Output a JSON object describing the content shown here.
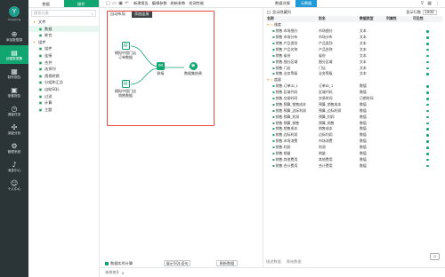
{
  "nav": {
    "logo_text": "Yonghong",
    "items": [
      {
        "label": "添加数据源",
        "icon": "plus-icon",
        "glyph": "⊕"
      },
      {
        "label": "创建数据集",
        "icon": "dataset-icon",
        "glyph": "▤",
        "active": true
      },
      {
        "label": "制作报告",
        "icon": "report-icon",
        "glyph": "▦"
      },
      {
        "label": "查看报告",
        "icon": "view-report-icon",
        "glyph": "▣"
      },
      {
        "label": "调度任务",
        "icon": "schedule-icon",
        "glyph": "◷"
      },
      {
        "label": "深度分析",
        "icon": "analysis-icon",
        "glyph": "✣"
      },
      {
        "label": "管理系统",
        "icon": "settings-icon",
        "glyph": "⚙"
      },
      {
        "label": "消息中心",
        "icon": "bell-icon",
        "glyph": "♪"
      },
      {
        "label": "个人中心",
        "icon": "user-icon",
        "glyph": "☺"
      }
    ]
  },
  "left": {
    "tabs": [
      "数据",
      "操作"
    ],
    "search_placeholder": "搜索元素",
    "tree": [
      {
        "label": "文件",
        "level": 0,
        "type": "folder"
      },
      {
        "label": "数据",
        "level": 1,
        "type": "item",
        "selected": true
      },
      {
        "label": "联合",
        "level": 1,
        "type": "item"
      },
      {
        "label": "组件",
        "level": 0,
        "type": "folder"
      },
      {
        "label": "组件",
        "level": 1,
        "type": "item"
      },
      {
        "label": "连接",
        "level": 1,
        "type": "item"
      },
      {
        "label": "合并",
        "level": 1,
        "type": "item"
      },
      {
        "label": "选择列",
        "level": 1,
        "type": "item"
      },
      {
        "label": "透视转换",
        "level": 1,
        "type": "item"
      },
      {
        "label": "分组和汇总",
        "level": 1,
        "type": "item"
      },
      {
        "label": "自助SQL",
        "level": 1,
        "type": "item"
      },
      {
        "label": "过滤",
        "level": 1,
        "type": "item"
      },
      {
        "label": "计算",
        "level": 1,
        "type": "item"
      },
      {
        "label": "主题",
        "level": 1,
        "type": "item"
      }
    ]
  },
  "toolbar": {
    "icons": [
      "新建",
      "打开",
      "保存",
      "撤销"
    ],
    "labels": [
      "新建报告",
      "编辑参数",
      "刷新参数",
      "检测性能"
    ]
  },
  "canvas": {
    "crumbs": [
      "自动布局",
      "添加连接"
    ],
    "nodes": [
      {
        "label1": "模拟中国门店",
        "label2": "订单数据"
      },
      {
        "label1": "模拟中国门店",
        "label2": "销售数据"
      },
      {
        "label1": "联接",
        "label2": ""
      },
      {
        "label1": "",
        "label2": ""
      },
      {
        "label1": "数据集结果",
        "label2": ""
      }
    ],
    "show_check_label": "数据实时计算",
    "btn_sql": "展示SQL语句",
    "btn_refresh": "刷新数据"
  },
  "right": {
    "tabs": [
      "数据详情",
      "元数据"
    ],
    "show_hidden": "显示隐藏列",
    "rows_label": "显示行数",
    "rows_value": "1000",
    "columns": [
      "名称",
      "别名",
      "数据类型",
      "列属性",
      "可见性"
    ],
    "groups": [
      {
        "name": "维度",
        "rows": [
          [
            "销售.市场细分",
            "市场细分",
            "文本"
          ],
          [
            "销售.市场分布",
            "市场分布",
            "文本"
          ],
          [
            "销售.产品类别",
            "产品类别",
            "文本"
          ],
          [
            "销售.产品名称",
            "产品名称",
            "文本"
          ],
          [
            "销售.省份",
            "省份",
            "文本"
          ],
          [
            "销售.细分区域",
            "细分区域",
            "文本"
          ],
          [
            "销售.门店",
            "门店",
            "文本"
          ],
          [
            "销售.业务等级",
            "业务等级",
            "文本"
          ]
        ]
      },
      {
        "name": "度量",
        "rows": [
          [
            "销售.订单ID_1",
            "订单ID_1",
            "数值"
          ],
          [
            "销售.区域代码",
            "区域代码",
            "数值"
          ],
          [
            "销售.交易时间",
            "交易时间",
            "日期时间"
          ],
          [
            "销售.预算_销售成本",
            "预算_销售成本",
            "数值"
          ],
          [
            "销售.预算_边际利润",
            "预算_边际利润",
            "数值"
          ],
          [
            "销售.预算_利润",
            "预算_利润",
            "数值"
          ],
          [
            "销售.预算_销售",
            "预算_销售",
            "数值"
          ],
          [
            "销售.销售成本",
            "销售成本",
            "数值"
          ],
          [
            "销售.边际利润",
            "边际利润",
            "数值"
          ],
          [
            "销售.市场消费",
            "市场消费",
            "数值"
          ],
          [
            "销售.利润",
            "利润",
            "数值"
          ],
          [
            "销售.销量",
            "销量",
            "数值"
          ],
          [
            "销售.其他费用",
            "其他费用",
            "数值"
          ],
          [
            "销售.合计费用",
            "合计费用",
            "数值"
          ]
        ]
      }
    ],
    "footer_tabs": [
      "描述数据",
      "原始数据"
    ]
  },
  "status": {
    "tabs": [
      "未命名0",
      "×"
    ]
  },
  "colors": {
    "accent": "#11a56f",
    "nav_bg": "#2b3437",
    "highlight": "#e8473f",
    "tab_blue": "#1e9bd7"
  }
}
